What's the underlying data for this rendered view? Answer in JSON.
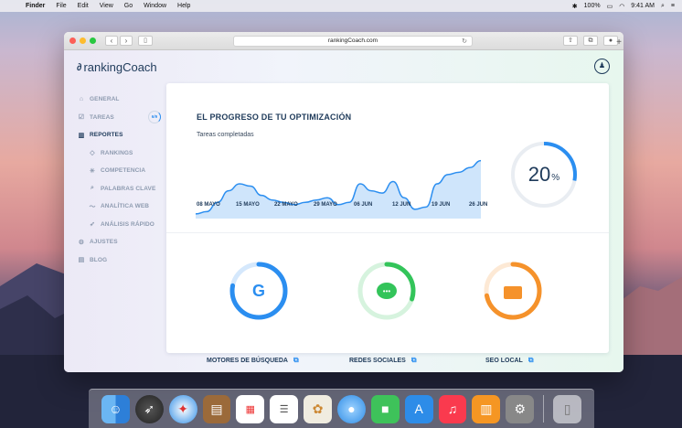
{
  "menubar": {
    "items": [
      "Finder",
      "File",
      "Edit",
      "View",
      "Go",
      "Window",
      "Help"
    ],
    "battery": "100%",
    "time": "9:41 AM"
  },
  "browser": {
    "url": "rankingCoach.com"
  },
  "app": {
    "logo": "rankingCoach",
    "nav": [
      {
        "label": "GENERAL",
        "icon": "home-icon"
      },
      {
        "label": "TAREAS",
        "icon": "checkbox-icon",
        "badge": "6/9"
      },
      {
        "label": "REPORTES",
        "icon": "chart-icon",
        "active": true
      },
      {
        "label": "RANKINGS",
        "icon": "tag-icon",
        "sub": true
      },
      {
        "label": "COMPETENCIA",
        "icon": "lightbulb-icon",
        "sub": true
      },
      {
        "label": "PALABRAS CLAVE",
        "icon": "search-icon",
        "sub": true
      },
      {
        "label": "ANALÍTICA WEB",
        "icon": "trend-icon",
        "sub": true
      },
      {
        "label": "ANÁLISIS RÁPIDO",
        "icon": "rocket-icon",
        "sub": true
      },
      {
        "label": "AJUSTES",
        "icon": "gear-icon"
      },
      {
        "label": "BLOG",
        "icon": "chat-icon"
      }
    ],
    "progress": {
      "title": "EL PROGRESO DE TU OPTIMIZACIÓN",
      "subtitle": "Tareas completadas",
      "percent_value": "20",
      "percent_sign": "%",
      "percent": 20
    },
    "categories": [
      {
        "label": "MOTORES DE BÚSQUEDA",
        "icon": "google-icon",
        "color": "#2b8ef0",
        "progress": 0.78
      },
      {
        "label": "REDES SOCIALES",
        "icon": "message-icon",
        "color": "#33c45a",
        "progress": 0.3
      },
      {
        "label": "SEO LOCAL",
        "icon": "briefcase-icon",
        "color": "#f5922b",
        "progress": 0.72
      }
    ]
  },
  "chart_data": {
    "type": "area",
    "x": [
      "08 MAYO",
      "15 MAYO",
      "22 MAYO",
      "29 MAYO",
      "06 JUN",
      "12 JUN",
      "19 JUN",
      "26 JUN"
    ],
    "series": [
      {
        "values": [
          2,
          3,
          7,
          12,
          15,
          14,
          10,
          8,
          7,
          6,
          7,
          8,
          9,
          6,
          7,
          15,
          12,
          11,
          16,
          9,
          4,
          5,
          15,
          19,
          20,
          22,
          25
        ]
      }
    ],
    "colors": {
      "line": "#2b8ef0",
      "fill": "#cfe5fb"
    }
  },
  "dock": [
    "finder-icon",
    "launchpad-icon",
    "safari-icon",
    "notes-icon",
    "calendar-icon",
    "reminders-icon",
    "photos-icon",
    "messages-icon",
    "facetime-icon",
    "appstore-icon",
    "music-icon",
    "books-icon",
    "preferences-icon",
    "trash-icon"
  ]
}
